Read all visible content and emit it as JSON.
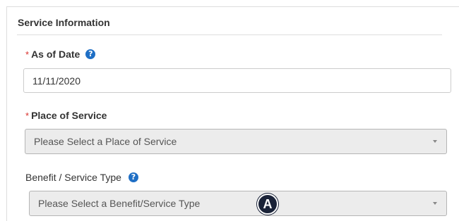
{
  "section": {
    "title": "Service Information"
  },
  "as_of_date": {
    "required_mark": "*",
    "label": "As of Date",
    "help_icon": "?",
    "value": "11/11/2020"
  },
  "place_of_service": {
    "required_mark": "*",
    "label": "Place of Service",
    "selected": "Please Select a Place of Service"
  },
  "benefit_service_type": {
    "label": "Benefit / Service Type",
    "help_icon": "?",
    "selected": "Please Select a Benefit/Service Type"
  },
  "callout": {
    "label": "A"
  },
  "icons": {
    "help": "question-circle-icon",
    "dropdown": "caret-down-icon"
  },
  "colors": {
    "required": "#d9302c",
    "help_icon": "#1f6fc5",
    "select_bg": "#ececec",
    "callout_bg": "#1a2338"
  }
}
